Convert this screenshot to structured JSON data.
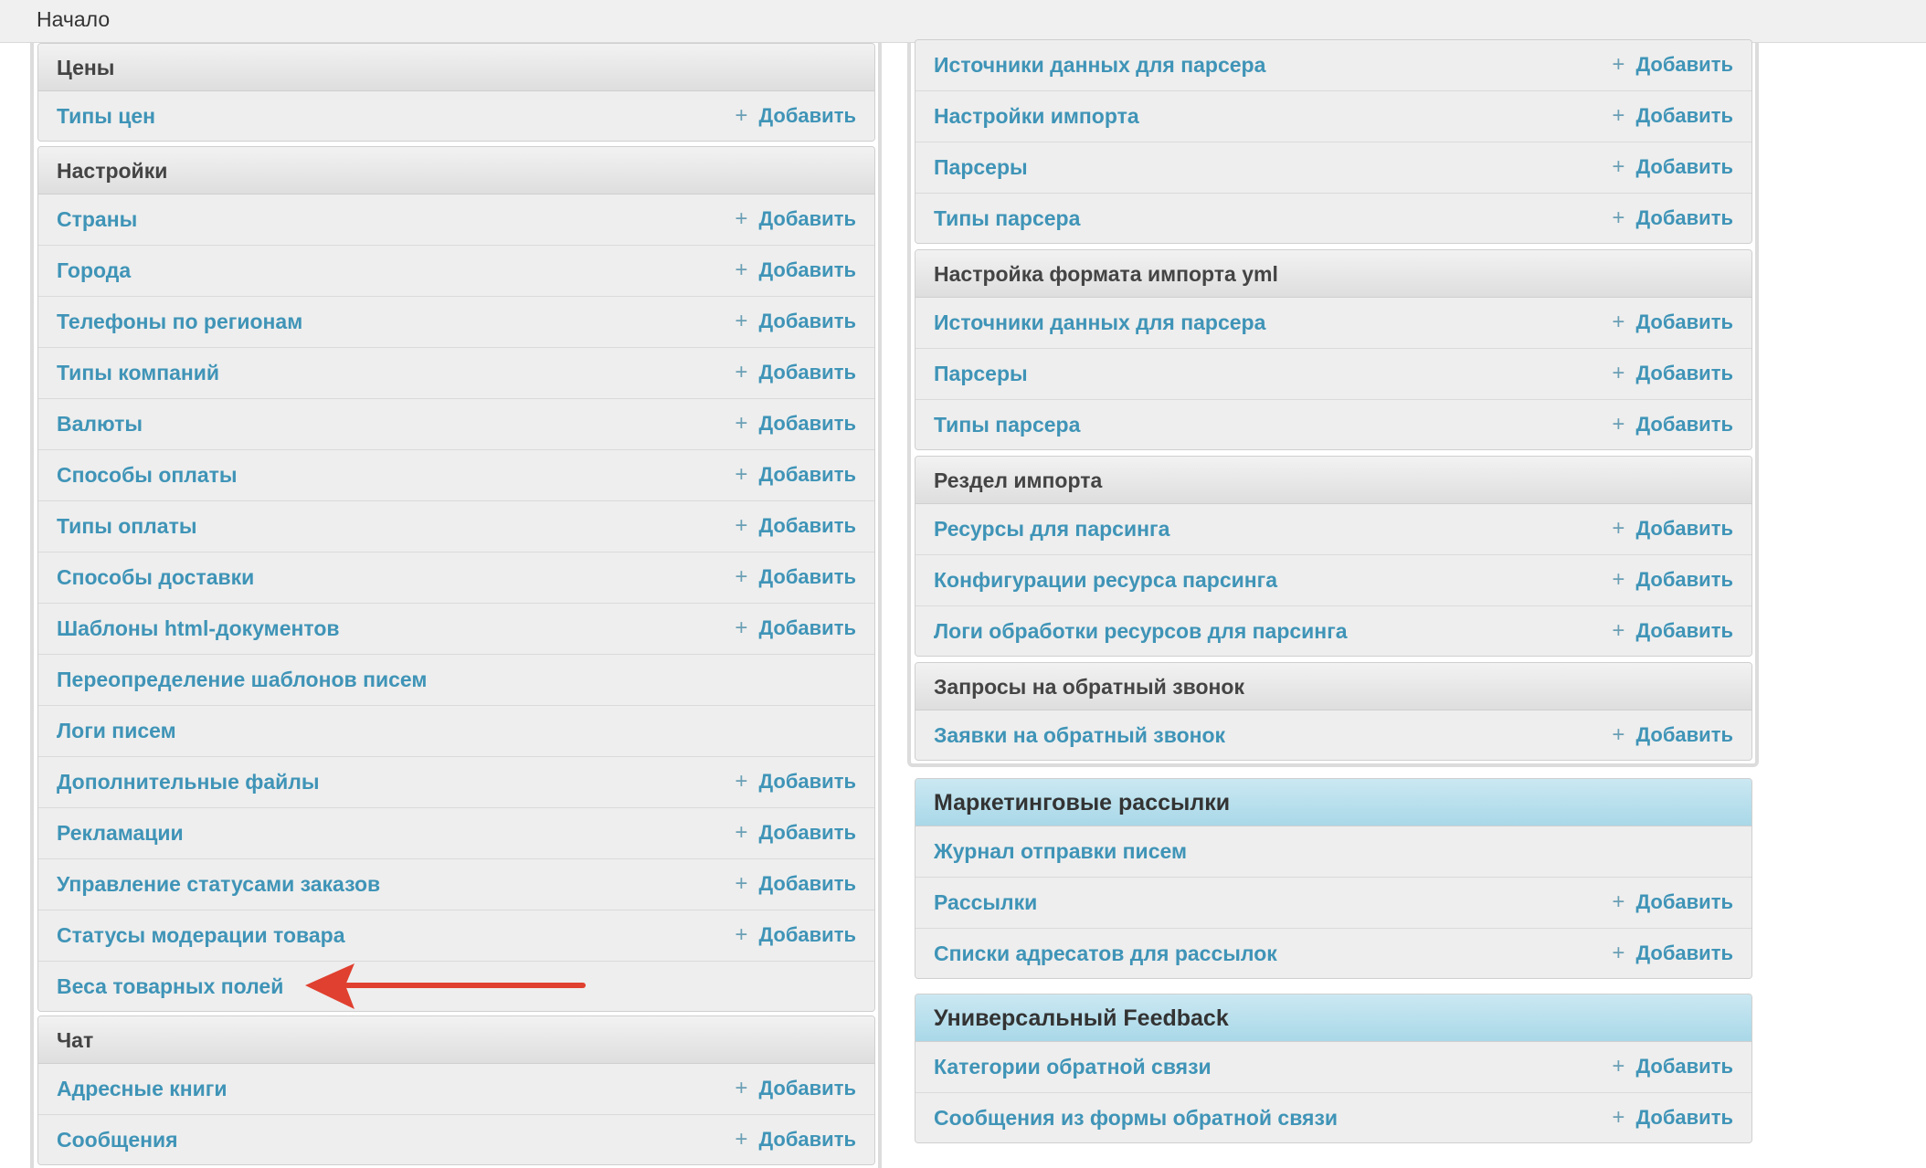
{
  "breadcrumb": "Начало",
  "add_label": "Добавить",
  "colors": {
    "link": "#3f94b7",
    "header_gray": "#e4e4e4",
    "header_blue": "#a9d8e8",
    "arrow": "#e0402f"
  },
  "icons": {
    "plus": "plus-icon",
    "arrow": "red-arrow-annotation"
  },
  "left_column": [
    {
      "title": "Цены",
      "items": [
        {
          "label": "Типы цен",
          "add": true
        }
      ]
    },
    {
      "title": "Настройки",
      "items": [
        {
          "label": "Страны",
          "add": true
        },
        {
          "label": "Города",
          "add": true
        },
        {
          "label": "Телефоны по регионам",
          "add": true
        },
        {
          "label": "Типы компаний",
          "add": true
        },
        {
          "label": "Валюты",
          "add": true
        },
        {
          "label": "Способы оплаты",
          "add": true
        },
        {
          "label": "Типы оплаты",
          "add": true
        },
        {
          "label": "Способы доставки",
          "add": true
        },
        {
          "label": "Шаблоны html-документов",
          "add": true
        },
        {
          "label": "Переопределение шаблонов писем",
          "add": false
        },
        {
          "label": "Логи писем",
          "add": false
        },
        {
          "label": "Дополнительные файлы",
          "add": true
        },
        {
          "label": "Рекламации",
          "add": true
        },
        {
          "label": "Управление статусами заказов",
          "add": true
        },
        {
          "label": "Статусы модерации товара",
          "add": true
        },
        {
          "label": "Веса товарных полей",
          "add": false
        }
      ]
    },
    {
      "title": "Чат",
      "items": [
        {
          "label": "Адресные книги",
          "add": true
        },
        {
          "label": "Сообщения",
          "add": true
        }
      ]
    }
  ],
  "right_column": [
    {
      "title": "",
      "items": [
        {
          "label": "Источники данных для парсера",
          "add": true
        },
        {
          "label": "Настройки импорта",
          "add": true
        },
        {
          "label": "Парсеры",
          "add": true
        },
        {
          "label": "Типы парсера",
          "add": true
        }
      ]
    },
    {
      "title": "Настройка формата импорта yml",
      "items": [
        {
          "label": "Источники данных для парсера",
          "add": true
        },
        {
          "label": "Парсеры",
          "add": true
        },
        {
          "label": "Типы парсера",
          "add": true
        }
      ]
    },
    {
      "title": "Рездел импорта",
      "items": [
        {
          "label": "Ресурсы для парсинга",
          "add": true
        },
        {
          "label": "Конфигурации ресурса парсинга",
          "add": true
        },
        {
          "label": "Логи обработки ресурсов для парсинга",
          "add": true
        }
      ]
    },
    {
      "title": "Запросы на обратный звонок",
      "items": [
        {
          "label": "Заявки на обратный звонок",
          "add": true
        }
      ]
    },
    {
      "title": "Маркетинговые рассылки",
      "blue": true,
      "items": [
        {
          "label": "Журнал отправки писем",
          "add": false
        },
        {
          "label": "Рассылки",
          "add": true
        },
        {
          "label": "Списки адресатов для рассылок",
          "add": true
        }
      ]
    },
    {
      "title": "Универсальный Feedback",
      "blue": true,
      "items": [
        {
          "label": "Категории обратной связи",
          "add": true
        },
        {
          "label": "Сообщения из формы обратной связи",
          "add": true
        }
      ]
    }
  ]
}
